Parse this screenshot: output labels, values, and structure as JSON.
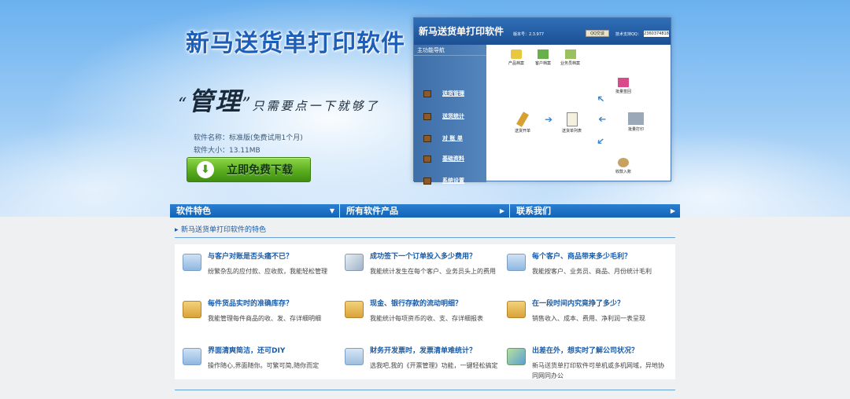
{
  "hero": {
    "title": "新马送货单打印软件",
    "slogan_open": "“",
    "slogan_main": "管理",
    "slogan_close": "”",
    "slogan_rest": "只需要点一下就够了",
    "software_name": "软件名称：标准版(免费试用1个月)",
    "software_size": "软件大小：13.11MB",
    "download_label": "立即免费下载"
  },
  "app": {
    "title": "新马送货单打印软件",
    "version": "版本号：2.3.977",
    "qq_label": "QQ交谈",
    "support": "技术支持QQ：",
    "phone": "2360374818",
    "sidebar_head": "主功能导航",
    "side_items": [
      "送货管理",
      "送货统计",
      "对 账 单",
      "基础资料",
      "系统设置"
    ],
    "top_icons": [
      "产品档案",
      "客户档案",
      "业务员档案"
    ],
    "flow": {
      "open": "送货开单",
      "list": "送货单列表",
      "batch_review": "批量签回",
      "batch_print": "批量打印",
      "receive": "收款入账"
    }
  },
  "nav": [
    "软件特色",
    "所有软件产品",
    "联系我们"
  ],
  "section_title": "新马送货单打印软件的特色",
  "features": [
    {
      "title": "与客户对账是否头痛不已？",
      "desc": "纷繁杂乱的应付款、应收款，我能轻松管理"
    },
    {
      "title": "成功签下一个订单投入多少费用？",
      "desc": "我能统计发生在每个客户、业务员头上的费用"
    },
    {
      "title": "每个客户、商品带来多少毛利？",
      "desc": "我能按客户、业务员、商品、月份统计毛利"
    },
    {
      "title": "每件货品实时的准确库存？",
      "desc": "我能管理每件商品的收、发、存详细明细"
    },
    {
      "title": "现金、银行存款的流动明细？",
      "desc": "我能统计每项资币的收、支、存详细报表"
    },
    {
      "title": "在一段时间内究竟挣了多少？",
      "desc": "销售收入、成本、费用、净利润一表呈现"
    },
    {
      "title": "界面清爽简洁，还可DIY",
      "desc": "操作随心,界面随你。可繁可简,随你而定"
    },
    {
      "title": "财务开发票时，发票清单难统计？",
      "desc": "选我吧,我的《开票管理》功能，一键轻松搞定"
    },
    {
      "title": "出差在外，想实时了解公司状况？",
      "desc": "新马送货单打印软件可单机或多机网域，异地协同网同办公"
    }
  ]
}
